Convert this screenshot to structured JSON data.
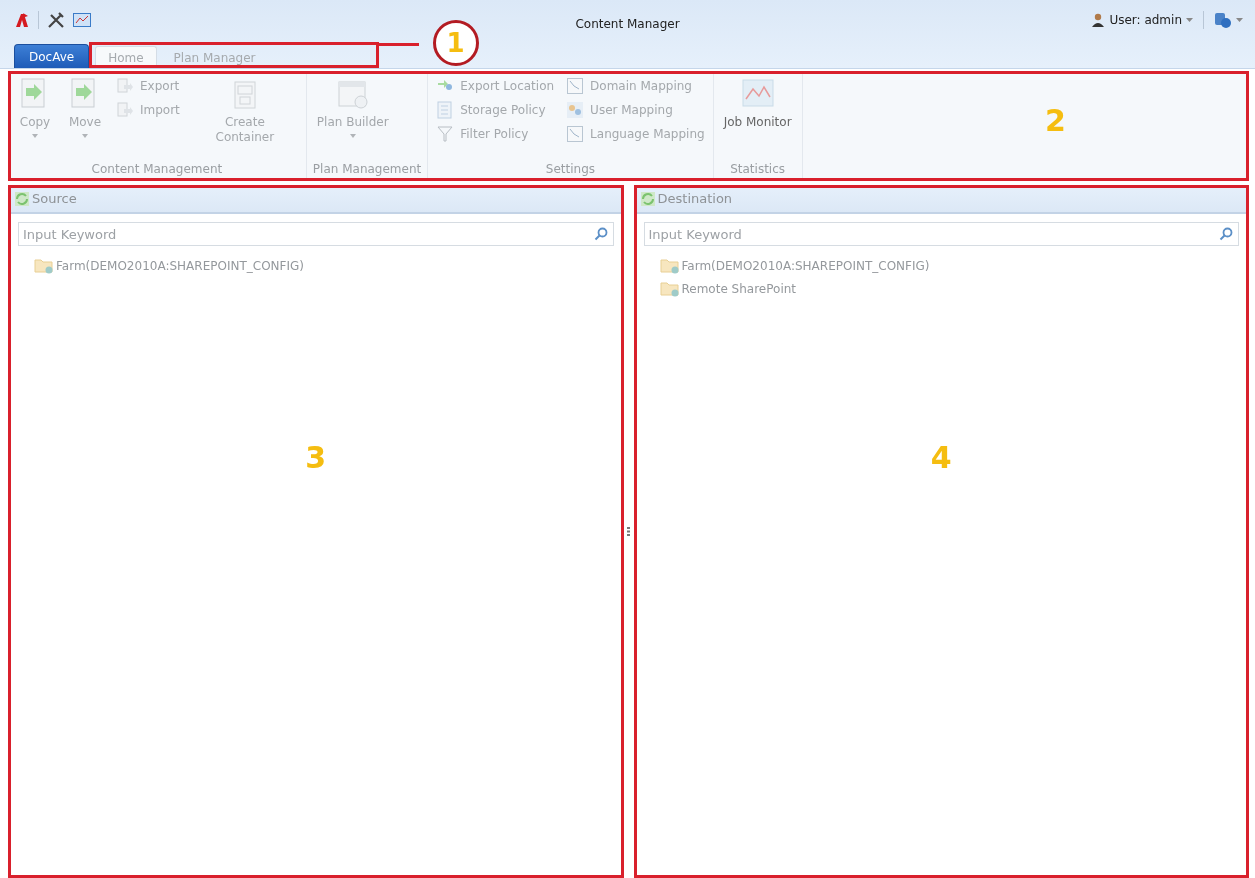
{
  "window": {
    "title": "Content Manager"
  },
  "user_menu": {
    "label": "User: admin"
  },
  "app_button": {
    "label": "DocAve"
  },
  "tabs": [
    {
      "label": "Home",
      "selected": true
    },
    {
      "label": "Plan Manager",
      "selected": false
    }
  ],
  "tabs_callout": "1",
  "ribbon": {
    "callout": "2",
    "groups": [
      {
        "label": "Content Management",
        "items": [
          {
            "kind": "large",
            "label": "Copy",
            "dropdown": true,
            "disabled": true
          },
          {
            "kind": "large",
            "label": "Move",
            "dropdown": true,
            "disabled": true
          },
          {
            "kind": "stack",
            "items": [
              {
                "label": "Export",
                "disabled": true
              },
              {
                "label": "Import",
                "disabled": true
              }
            ]
          },
          {
            "kind": "large",
            "label": "Create Container",
            "disabled": true
          }
        ]
      },
      {
        "label": "Plan Management",
        "items": [
          {
            "kind": "large",
            "label": "Plan Builder",
            "dropdown": true,
            "disabled": true
          }
        ]
      },
      {
        "label": "Settings",
        "items": [
          {
            "kind": "stack",
            "items": [
              {
                "label": "Export Location",
                "disabled": true
              },
              {
                "label": "Storage Policy",
                "disabled": true
              },
              {
                "label": "Filter Policy",
                "disabled": true
              }
            ]
          },
          {
            "kind": "stack",
            "items": [
              {
                "label": "Domain Mapping",
                "disabled": true
              },
              {
                "label": "User Mapping",
                "disabled": true
              },
              {
                "label": "Language Mapping",
                "disabled": true
              }
            ]
          }
        ]
      },
      {
        "label": "Statistics",
        "items": [
          {
            "kind": "large",
            "label": "Job Monitor",
            "disabled": false
          }
        ]
      }
    ]
  },
  "panels": [
    {
      "title": "Source",
      "search": {
        "placeholder": "Input Keyword"
      },
      "callout": "3",
      "tree": [
        {
          "label": "Farm(DEMO2010A:SHAREPOINT_CONFIG)"
        }
      ]
    },
    {
      "title": "Destination",
      "search": {
        "placeholder": "Input Keyword"
      },
      "callout": "4",
      "tree": [
        {
          "label": "Farm(DEMO2010A:SHAREPOINT_CONFIG)"
        },
        {
          "label": "Remote SharePoint"
        }
      ]
    }
  ]
}
